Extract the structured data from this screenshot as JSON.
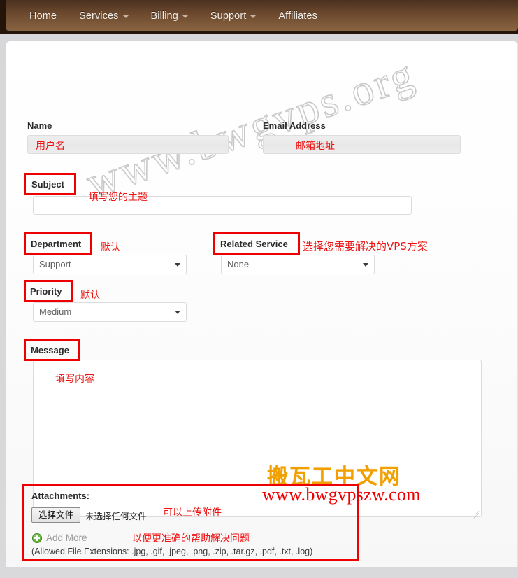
{
  "navbar": {
    "items": [
      {
        "label": "Home",
        "has_caret": false
      },
      {
        "label": "Services",
        "has_caret": true
      },
      {
        "label": "Billing",
        "has_caret": true
      },
      {
        "label": "Support",
        "has_caret": true
      },
      {
        "label": "Affiliates",
        "has_caret": false
      }
    ]
  },
  "form": {
    "name": {
      "label": "Name",
      "value": "",
      "annotation": "用户名"
    },
    "email": {
      "label": "Email Address",
      "value": "",
      "annotation": "邮箱地址"
    },
    "subject": {
      "label": "Subject",
      "value": "",
      "annotation": "填写您的主题"
    },
    "department": {
      "label": "Department",
      "selected": "Support",
      "annotation": "默认"
    },
    "related_service": {
      "label": "Related Service",
      "selected": "None",
      "annotation": "选择您需要解决的VPS方案"
    },
    "priority": {
      "label": "Priority",
      "selected": "Medium",
      "annotation": "默认"
    },
    "message": {
      "label": "Message",
      "value": "",
      "annotation": "填写内容"
    },
    "attachments": {
      "label": "Attachments:",
      "file_button": "选择文件",
      "file_status": "未选择任何文件",
      "add_more": "Add More",
      "allowed": "(Allowed File Extensions: .jpg, .gif, .jpeg, .png, .zip, .tar.gz, .pdf, .txt, .log)",
      "annotation_1": "可以上传附件",
      "annotation_2": "以便更准确的帮助解决问题"
    }
  },
  "watermarks": {
    "diagonal": "www.bwgvps.org",
    "orange_cn": "搬瓦工中文网",
    "red_url": "www.bwgvpszw.com"
  },
  "colors": {
    "navbar_brown": "#6d4a2e",
    "annotation_red": "#ee0000",
    "orange": "#f0a000",
    "page_grey": "#d8d8da"
  }
}
